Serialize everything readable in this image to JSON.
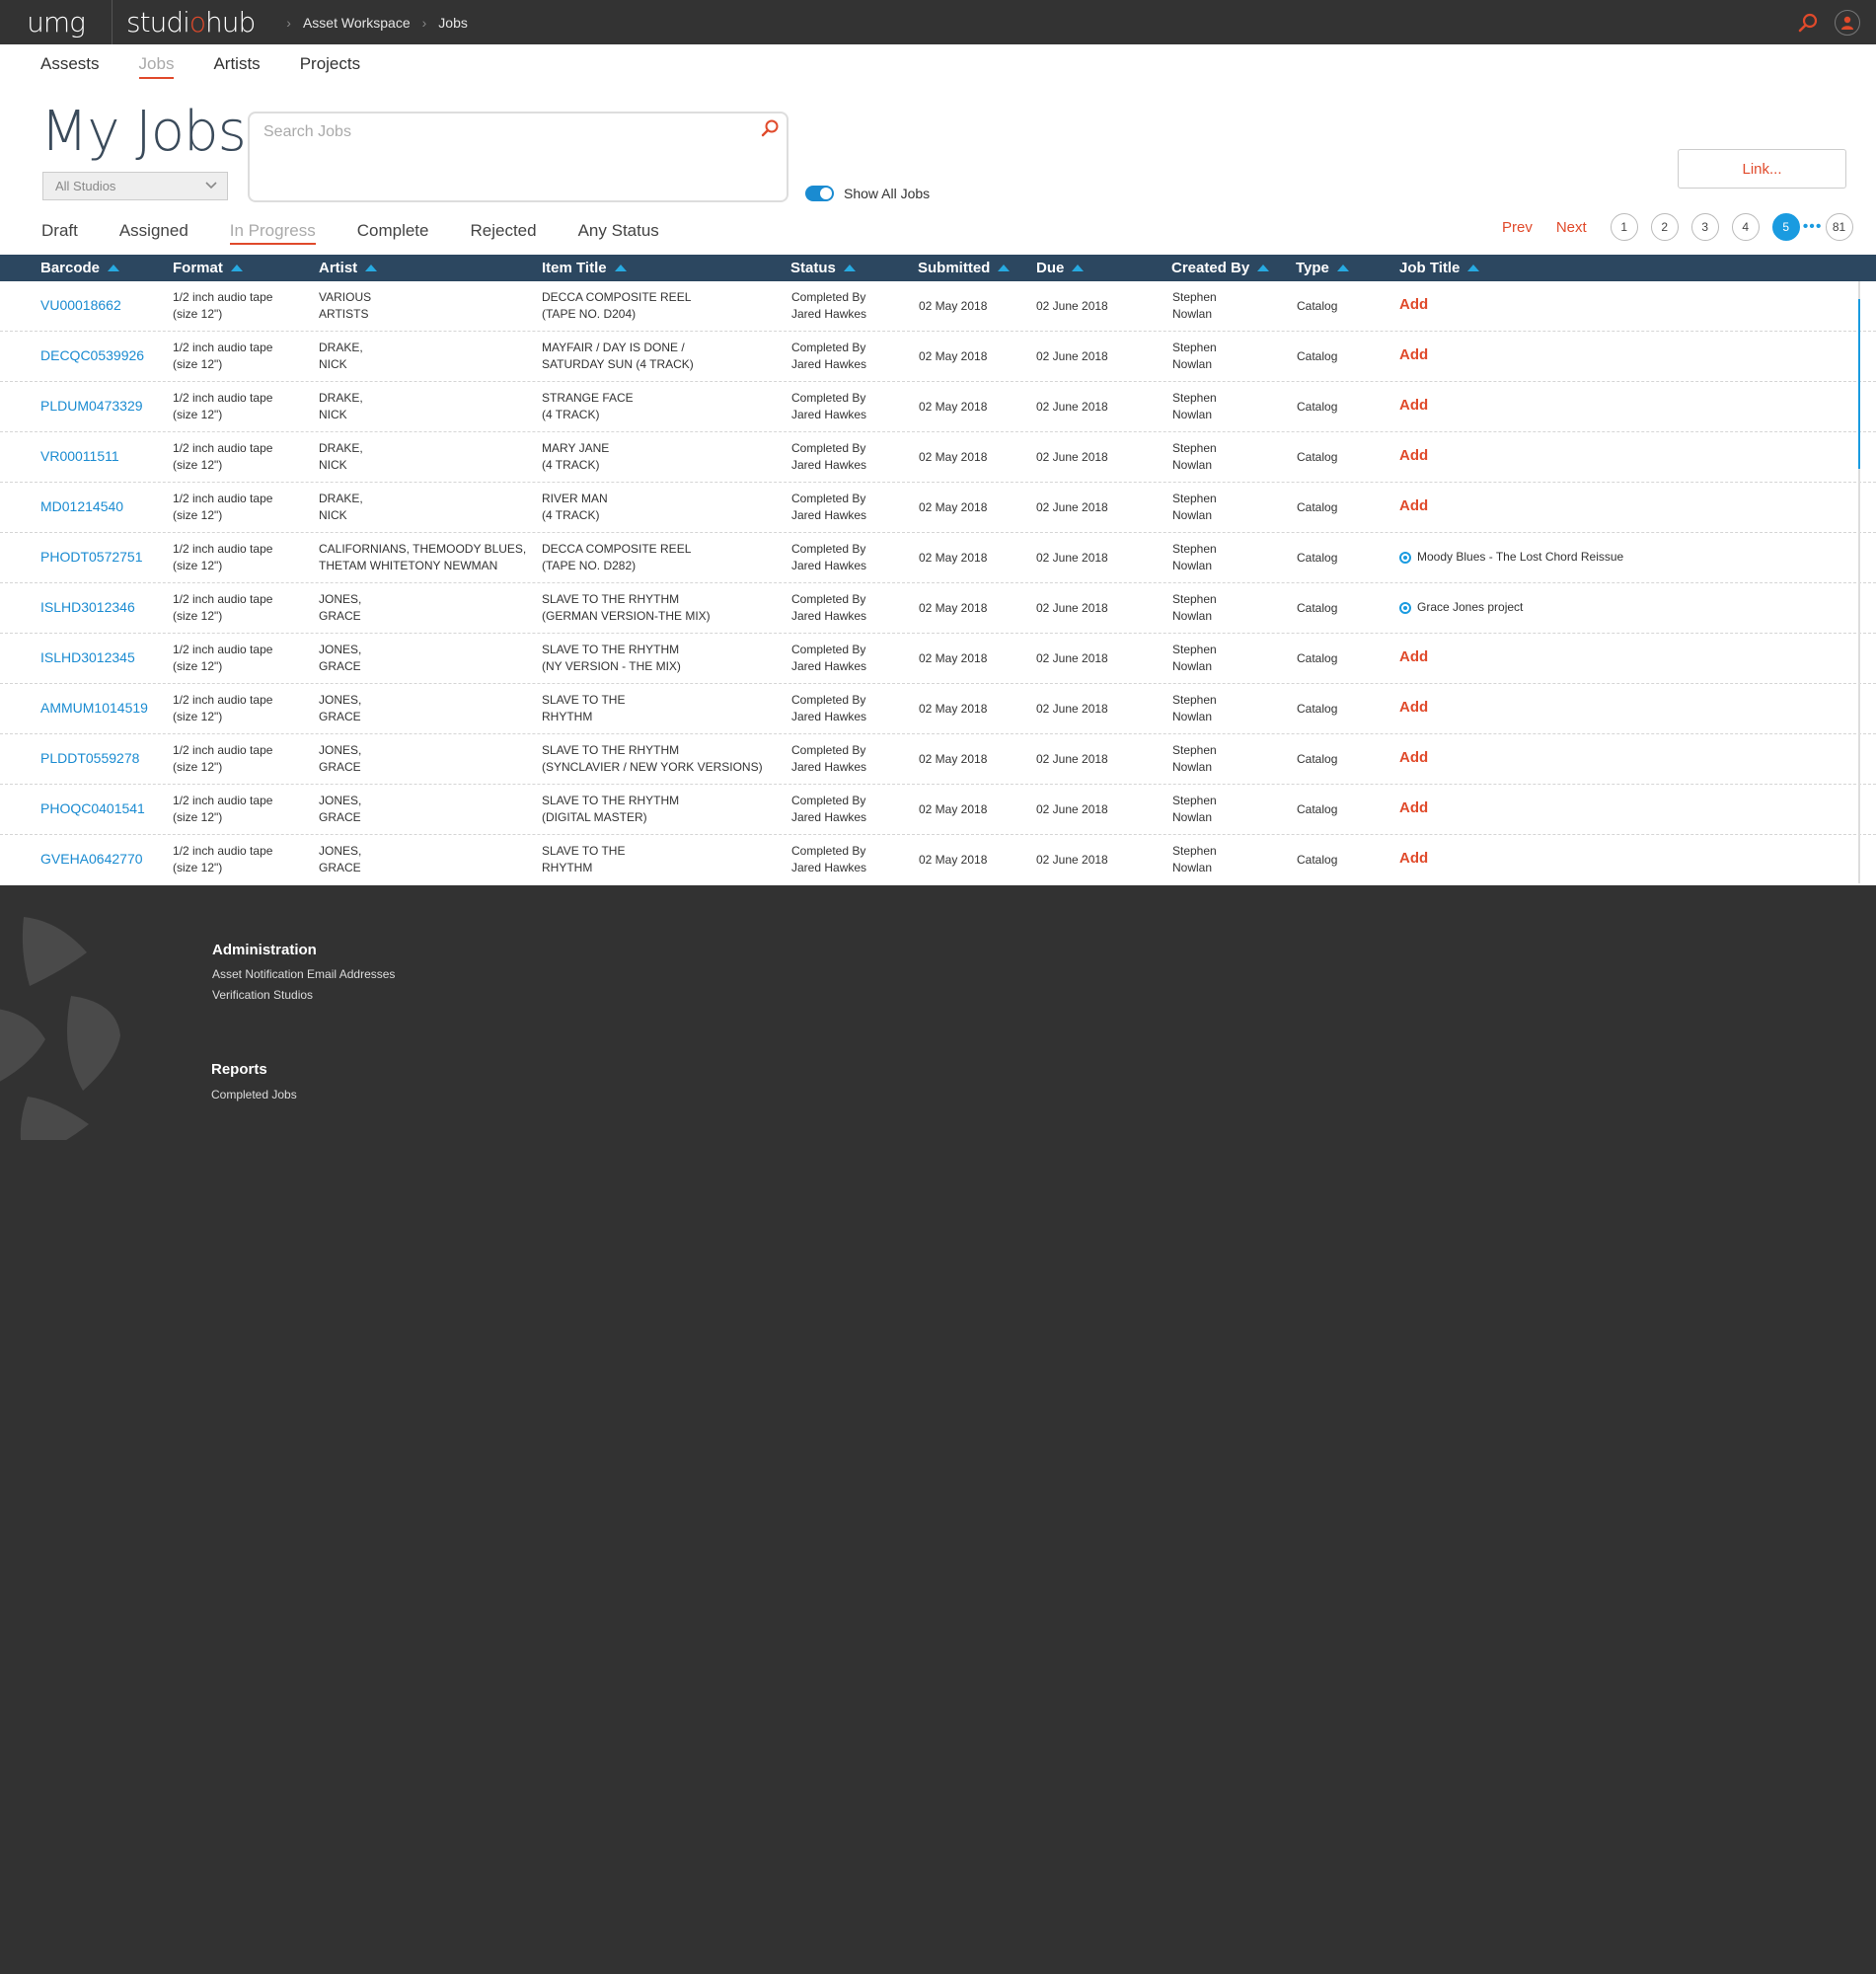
{
  "header": {
    "logo_left": "umg",
    "logo_app_a": "studi",
    "logo_app_o": "o",
    "logo_app_b": "hub",
    "breadcrumb": [
      "Asset Workspace",
      "Jobs"
    ],
    "icons": [
      "search-icon",
      "user-icon"
    ],
    "accent": "#e04a2b"
  },
  "nav": {
    "items": [
      "Assests",
      "Jobs",
      "Artists",
      "Projects"
    ],
    "active": "Jobs"
  },
  "page": {
    "title": "My Jobs",
    "studio_filter": "All Studios",
    "search_placeholder": "Search Jobs",
    "show_all_label": "Show All Jobs",
    "show_all_on": true,
    "link_button": "Link..."
  },
  "status_tabs": {
    "items": [
      "Draft",
      "Assigned",
      "In Progress",
      "Complete",
      "Rejected",
      "Any Status"
    ],
    "active": "In Progress"
  },
  "pagination": {
    "prev": "Prev",
    "next": "Next",
    "pages": [
      "1",
      "2",
      "3",
      "4",
      "5"
    ],
    "current": "5",
    "ellipsis": "•••",
    "last": "81"
  },
  "table": {
    "columns": [
      "Barcode",
      "Format",
      "Artist",
      "Item Title",
      "Status",
      "Submitted",
      "Due",
      "Created By",
      "Type",
      "Job Title"
    ],
    "rows": [
      {
        "barcode": "VU00018662",
        "format": [
          "1/2 inch audio tape",
          "(size 12\")"
        ],
        "artist": [
          "VARIOUS",
          "ARTISTS"
        ],
        "title": [
          "DECCA COMPOSITE REEL",
          "(TAPE NO. D204)"
        ],
        "status": [
          "Completed By",
          "Jared Hawkes"
        ],
        "submitted": "02 May 2018",
        "due": "02 June 2018",
        "created_by": [
          "Stephen",
          "Nowlan"
        ],
        "type": "Catalog",
        "job_title": "Add",
        "job_linked": false
      },
      {
        "barcode": "DECQC0539926",
        "format": [
          "1/2 inch audio tape",
          "(size 12\")"
        ],
        "artist": [
          "DRAKE,",
          "NICK"
        ],
        "title": [
          "MAYFAIR / DAY IS DONE /",
          "SATURDAY SUN (4 TRACK)"
        ],
        "status": [
          "Completed By",
          "Jared Hawkes"
        ],
        "submitted": "02 May 2018",
        "due": "02 June 2018",
        "created_by": [
          "Stephen",
          "Nowlan"
        ],
        "type": "Catalog",
        "job_title": "Add",
        "job_linked": false
      },
      {
        "barcode": "PLDUM0473329",
        "format": [
          "1/2 inch audio tape",
          "(size 12\")"
        ],
        "artist": [
          "DRAKE,",
          "NICK"
        ],
        "title": [
          "STRANGE FACE",
          "(4 TRACK)"
        ],
        "status": [
          "Completed By",
          "Jared Hawkes"
        ],
        "submitted": "02 May 2018",
        "due": "02 June 2018",
        "created_by": [
          "Stephen",
          "Nowlan"
        ],
        "type": "Catalog",
        "job_title": "Add",
        "job_linked": false
      },
      {
        "barcode": "VR00011511",
        "format": [
          "1/2 inch audio tape",
          "(size 12\")"
        ],
        "artist": [
          "DRAKE,",
          "NICK"
        ],
        "title": [
          "MARY JANE",
          "(4 TRACK)"
        ],
        "status": [
          "Completed By",
          "Jared Hawkes"
        ],
        "submitted": "02 May 2018",
        "due": "02 June 2018",
        "created_by": [
          "Stephen",
          "Nowlan"
        ],
        "type": "Catalog",
        "job_title": "Add",
        "job_linked": false
      },
      {
        "barcode": "MD01214540",
        "format": [
          "1/2 inch audio tape",
          "(size 12\")"
        ],
        "artist": [
          "DRAKE,",
          "NICK"
        ],
        "title": [
          "RIVER MAN",
          "(4 TRACK)"
        ],
        "status": [
          "Completed By",
          "Jared Hawkes"
        ],
        "submitted": "02 May 2018",
        "due": "02 June 2018",
        "created_by": [
          "Stephen",
          "Nowlan"
        ],
        "type": "Catalog",
        "job_title": "Add",
        "job_linked": false
      },
      {
        "barcode": "PHODT0572751",
        "format": [
          "1/2 inch audio tape",
          "(size 12\")"
        ],
        "artist": [
          "CALIFORNIANS, THEMOODY BLUES,",
          "THETAM WHITETONY NEWMAN"
        ],
        "title": [
          "DECCA COMPOSITE REEL",
          "(TAPE NO. D282)"
        ],
        "status": [
          "Completed By",
          "Jared Hawkes"
        ],
        "submitted": "02 May 2018",
        "due": "02 June 2018",
        "created_by": [
          "Stephen",
          "Nowlan"
        ],
        "type": "Catalog",
        "job_title": "Moody Blues - The Lost Chord Reissue",
        "job_linked": true
      },
      {
        "barcode": "ISLHD3012346",
        "format": [
          "1/2 inch audio tape",
          "(size 12\")"
        ],
        "artist": [
          "JONES,",
          "GRACE"
        ],
        "title": [
          "SLAVE TO THE RHYTHM",
          "(GERMAN VERSION-THE MIX)"
        ],
        "status": [
          "Completed By",
          "Jared Hawkes"
        ],
        "submitted": "02 May 2018",
        "due": "02 June 2018",
        "created_by": [
          "Stephen",
          "Nowlan"
        ],
        "type": "Catalog",
        "job_title": "Grace Jones project",
        "job_linked": true
      },
      {
        "barcode": "ISLHD3012345",
        "format": [
          "1/2 inch audio tape",
          "(size 12\")"
        ],
        "artist": [
          "JONES,",
          "GRACE"
        ],
        "title": [
          "SLAVE TO THE RHYTHM",
          "(NY VERSION - THE MIX)"
        ],
        "status": [
          "Completed By",
          "Jared Hawkes"
        ],
        "submitted": "02 May 2018",
        "due": "02 June 2018",
        "created_by": [
          "Stephen",
          "Nowlan"
        ],
        "type": "Catalog",
        "job_title": "Add",
        "job_linked": false
      },
      {
        "barcode": "AMMUM1014519",
        "format": [
          "1/2 inch audio tape",
          "(size 12\")"
        ],
        "artist": [
          "JONES,",
          "GRACE"
        ],
        "title": [
          "SLAVE TO THE",
          "RHYTHM"
        ],
        "status": [
          "Completed By",
          "Jared Hawkes"
        ],
        "submitted": "02 May 2018",
        "due": "02 June 2018",
        "created_by": [
          "Stephen",
          "Nowlan"
        ],
        "type": "Catalog",
        "job_title": "Add",
        "job_linked": false
      },
      {
        "barcode": "PLDDT0559278",
        "format": [
          "1/2 inch audio tape",
          "(size 12\")"
        ],
        "artist": [
          "JONES,",
          "GRACE"
        ],
        "title": [
          "SLAVE TO THE RHYTHM",
          "(SYNCLAVIER / NEW YORK VERSIONS)"
        ],
        "status": [
          "Completed By",
          "Jared Hawkes"
        ],
        "submitted": "02 May 2018",
        "due": "02 June 2018",
        "created_by": [
          "Stephen",
          "Nowlan"
        ],
        "type": "Catalog",
        "job_title": "Add",
        "job_linked": false
      },
      {
        "barcode": "PHOQC0401541",
        "format": [
          "1/2 inch audio tape",
          "(size 12\")"
        ],
        "artist": [
          "JONES,",
          "GRACE"
        ],
        "title": [
          "SLAVE TO THE RHYTHM",
          "(DIGITAL MASTER)"
        ],
        "status": [
          "Completed By",
          "Jared Hawkes"
        ],
        "submitted": "02 May 2018",
        "due": "02 June 2018",
        "created_by": [
          "Stephen",
          "Nowlan"
        ],
        "type": "Catalog",
        "job_title": "Add",
        "job_linked": false
      },
      {
        "barcode": "GVEHA0642770",
        "format": [
          "1/2 inch audio tape",
          "(size 12\")"
        ],
        "artist": [
          "JONES,",
          "GRACE"
        ],
        "title": [
          "SLAVE TO THE",
          "RHYTHM"
        ],
        "status": [
          "Completed By",
          "Jared Hawkes"
        ],
        "submitted": "02 May 2018",
        "due": "02 June 2018",
        "created_by": [
          "Stephen",
          "Nowlan"
        ],
        "type": "Catalog",
        "job_title": "Add",
        "job_linked": false
      }
    ]
  },
  "footer": {
    "sections": [
      {
        "title": "Administration",
        "links": [
          "Asset Notification Email Addresses",
          "Verification Studios"
        ]
      },
      {
        "title": "Reports",
        "links": [
          "Completed Jobs"
        ]
      }
    ]
  }
}
